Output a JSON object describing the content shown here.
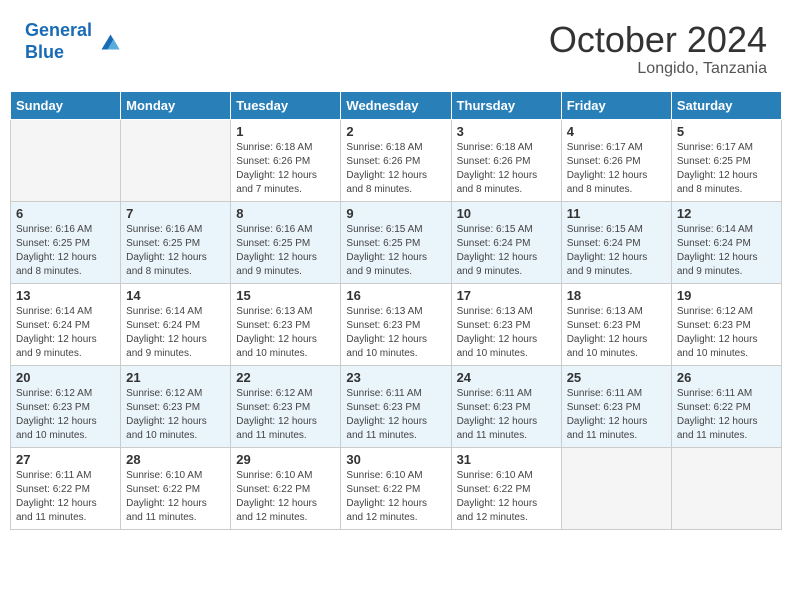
{
  "header": {
    "logo_line1": "General",
    "logo_line2": "Blue",
    "month": "October 2024",
    "location": "Longido, Tanzania"
  },
  "weekdays": [
    "Sunday",
    "Monday",
    "Tuesday",
    "Wednesday",
    "Thursday",
    "Friday",
    "Saturday"
  ],
  "weeks": [
    [
      {
        "day": "",
        "info": ""
      },
      {
        "day": "",
        "info": ""
      },
      {
        "day": "1",
        "info": "Sunrise: 6:18 AM\nSunset: 6:26 PM\nDaylight: 12 hours and 7 minutes."
      },
      {
        "day": "2",
        "info": "Sunrise: 6:18 AM\nSunset: 6:26 PM\nDaylight: 12 hours and 8 minutes."
      },
      {
        "day": "3",
        "info": "Sunrise: 6:18 AM\nSunset: 6:26 PM\nDaylight: 12 hours and 8 minutes."
      },
      {
        "day": "4",
        "info": "Sunrise: 6:17 AM\nSunset: 6:26 PM\nDaylight: 12 hours and 8 minutes."
      },
      {
        "day": "5",
        "info": "Sunrise: 6:17 AM\nSunset: 6:25 PM\nDaylight: 12 hours and 8 minutes."
      }
    ],
    [
      {
        "day": "6",
        "info": "Sunrise: 6:16 AM\nSunset: 6:25 PM\nDaylight: 12 hours and 8 minutes."
      },
      {
        "day": "7",
        "info": "Sunrise: 6:16 AM\nSunset: 6:25 PM\nDaylight: 12 hours and 8 minutes."
      },
      {
        "day": "8",
        "info": "Sunrise: 6:16 AM\nSunset: 6:25 PM\nDaylight: 12 hours and 9 minutes."
      },
      {
        "day": "9",
        "info": "Sunrise: 6:15 AM\nSunset: 6:25 PM\nDaylight: 12 hours and 9 minutes."
      },
      {
        "day": "10",
        "info": "Sunrise: 6:15 AM\nSunset: 6:24 PM\nDaylight: 12 hours and 9 minutes."
      },
      {
        "day": "11",
        "info": "Sunrise: 6:15 AM\nSunset: 6:24 PM\nDaylight: 12 hours and 9 minutes."
      },
      {
        "day": "12",
        "info": "Sunrise: 6:14 AM\nSunset: 6:24 PM\nDaylight: 12 hours and 9 minutes."
      }
    ],
    [
      {
        "day": "13",
        "info": "Sunrise: 6:14 AM\nSunset: 6:24 PM\nDaylight: 12 hours and 9 minutes."
      },
      {
        "day": "14",
        "info": "Sunrise: 6:14 AM\nSunset: 6:24 PM\nDaylight: 12 hours and 9 minutes."
      },
      {
        "day": "15",
        "info": "Sunrise: 6:13 AM\nSunset: 6:23 PM\nDaylight: 12 hours and 10 minutes."
      },
      {
        "day": "16",
        "info": "Sunrise: 6:13 AM\nSunset: 6:23 PM\nDaylight: 12 hours and 10 minutes."
      },
      {
        "day": "17",
        "info": "Sunrise: 6:13 AM\nSunset: 6:23 PM\nDaylight: 12 hours and 10 minutes."
      },
      {
        "day": "18",
        "info": "Sunrise: 6:13 AM\nSunset: 6:23 PM\nDaylight: 12 hours and 10 minutes."
      },
      {
        "day": "19",
        "info": "Sunrise: 6:12 AM\nSunset: 6:23 PM\nDaylight: 12 hours and 10 minutes."
      }
    ],
    [
      {
        "day": "20",
        "info": "Sunrise: 6:12 AM\nSunset: 6:23 PM\nDaylight: 12 hours and 10 minutes."
      },
      {
        "day": "21",
        "info": "Sunrise: 6:12 AM\nSunset: 6:23 PM\nDaylight: 12 hours and 10 minutes."
      },
      {
        "day": "22",
        "info": "Sunrise: 6:12 AM\nSunset: 6:23 PM\nDaylight: 12 hours and 11 minutes."
      },
      {
        "day": "23",
        "info": "Sunrise: 6:11 AM\nSunset: 6:23 PM\nDaylight: 12 hours and 11 minutes."
      },
      {
        "day": "24",
        "info": "Sunrise: 6:11 AM\nSunset: 6:23 PM\nDaylight: 12 hours and 11 minutes."
      },
      {
        "day": "25",
        "info": "Sunrise: 6:11 AM\nSunset: 6:23 PM\nDaylight: 12 hours and 11 minutes."
      },
      {
        "day": "26",
        "info": "Sunrise: 6:11 AM\nSunset: 6:22 PM\nDaylight: 12 hours and 11 minutes."
      }
    ],
    [
      {
        "day": "27",
        "info": "Sunrise: 6:11 AM\nSunset: 6:22 PM\nDaylight: 12 hours and 11 minutes."
      },
      {
        "day": "28",
        "info": "Sunrise: 6:10 AM\nSunset: 6:22 PM\nDaylight: 12 hours and 11 minutes."
      },
      {
        "day": "29",
        "info": "Sunrise: 6:10 AM\nSunset: 6:22 PM\nDaylight: 12 hours and 12 minutes."
      },
      {
        "day": "30",
        "info": "Sunrise: 6:10 AM\nSunset: 6:22 PM\nDaylight: 12 hours and 12 minutes."
      },
      {
        "day": "31",
        "info": "Sunrise: 6:10 AM\nSunset: 6:22 PM\nDaylight: 12 hours and 12 minutes."
      },
      {
        "day": "",
        "info": ""
      },
      {
        "day": "",
        "info": ""
      }
    ]
  ]
}
